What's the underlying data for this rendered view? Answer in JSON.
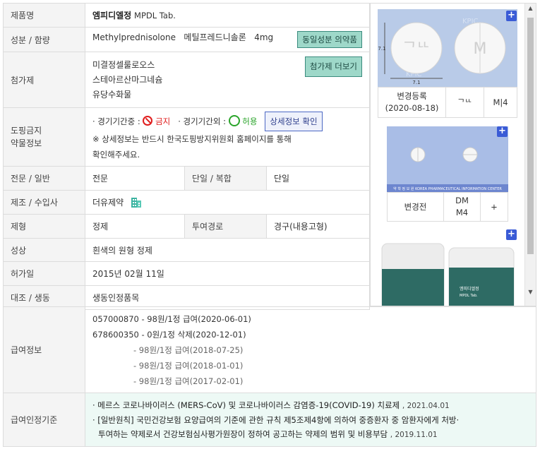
{
  "rows": {
    "product": {
      "label": "제품명",
      "name": "엠피디엘정",
      "en": "MPDL Tab."
    },
    "ingredient": {
      "label": "성분 / 함량",
      "en": "Methylprednisolone",
      "ko": "메틸프레드니솔론",
      "amount": "4mg",
      "button": "동일성분 의약품"
    },
    "excipient": {
      "label": "첨가제",
      "items": [
        "미결정셀룰로오스",
        "스테아르산마그네슘",
        "유당수화물"
      ],
      "button": "첨가제 더보기"
    },
    "doping": {
      "label1": "도핑금지",
      "label2": "약물정보",
      "in_comp": "· 경기기간중 :",
      "ban": "금지",
      "out_comp": "· 경기기간외 :",
      "allow": "허용",
      "button": "상세정보 확인",
      "note1": "※ 상세정보는 반드시 한국도핑방지위원회 홈페이지를 통해",
      "note2": "확인해주세요."
    },
    "type": {
      "label": "전문 / 일반",
      "value": "전문",
      "label2": "단일 / 복합",
      "value2": "단일"
    },
    "maker": {
      "label": "제조 / 수입사",
      "value": "더유제약"
    },
    "form": {
      "label": "제형",
      "value": "정제",
      "label2": "투여경로",
      "value2": "경구(내용고형)"
    },
    "appearance": {
      "label": "성상",
      "value": "흰색의 원형 정제"
    },
    "approval": {
      "label": "허가일",
      "value": "2015년 02월 11일"
    },
    "equiv": {
      "label": "대조 / 생동",
      "value": "생동인정품목"
    }
  },
  "reimbursement": {
    "label": "급여정보",
    "lines": [
      "057000870 - 98원/1정 급여(2020-06-01)",
      "678600350 - 0원/1정 삭제(2020-12-01)"
    ],
    "history": [
      "- 98원/1정 급여(2018-07-25)",
      "- 98원/1정 급여(2018-01-01)",
      "- 98원/1정 급여(2017-02-01)"
    ]
  },
  "criteria": {
    "label": "급여인정기준",
    "item1": "· 메르스 코로나바이러스 (MERS-CoV) 및 코로나바이러스 감염증-19(COVID-19) 치료제",
    "date1": ", 2021.04.01",
    "item2a": "· [일반원칙] 국민건강보험 요양급여의 기준에 관한 규칙 제5조제4항에 의하여 중증환자 중 암환자에게 처방·",
    "item2b": "투여하는 약제로서 건강보험심사평가원장이 정하여 공고하는 약제의 범위 및 비용부담",
    "date2": ", 2019.11.01"
  },
  "images": {
    "img1": {
      "caption": "변경등록",
      "date": "(2020-08-18)",
      "mark1": "ᄀᄔ",
      "mark2": "M|4",
      "dim1": "7.1",
      "dim2": "7.1",
      "watermark": "KPIC"
    },
    "img2": {
      "caption": "변경전",
      "mark1": "DM",
      "mark2": "M4",
      "mark3": "+",
      "footer": "약 학 정 보 원   KOREA PHARMACEUTICAL INFORMATION CENTER"
    },
    "img3": {
      "label1": "엠피디엘정",
      "label2": "MPDL Tab."
    }
  },
  "plus_label": "+",
  "colors": {
    "green_tag": "#9ed8c9",
    "plus_blue": "#3a5bd6",
    "ban_red": "#e01e1e",
    "allow_green": "#2aa42a"
  }
}
